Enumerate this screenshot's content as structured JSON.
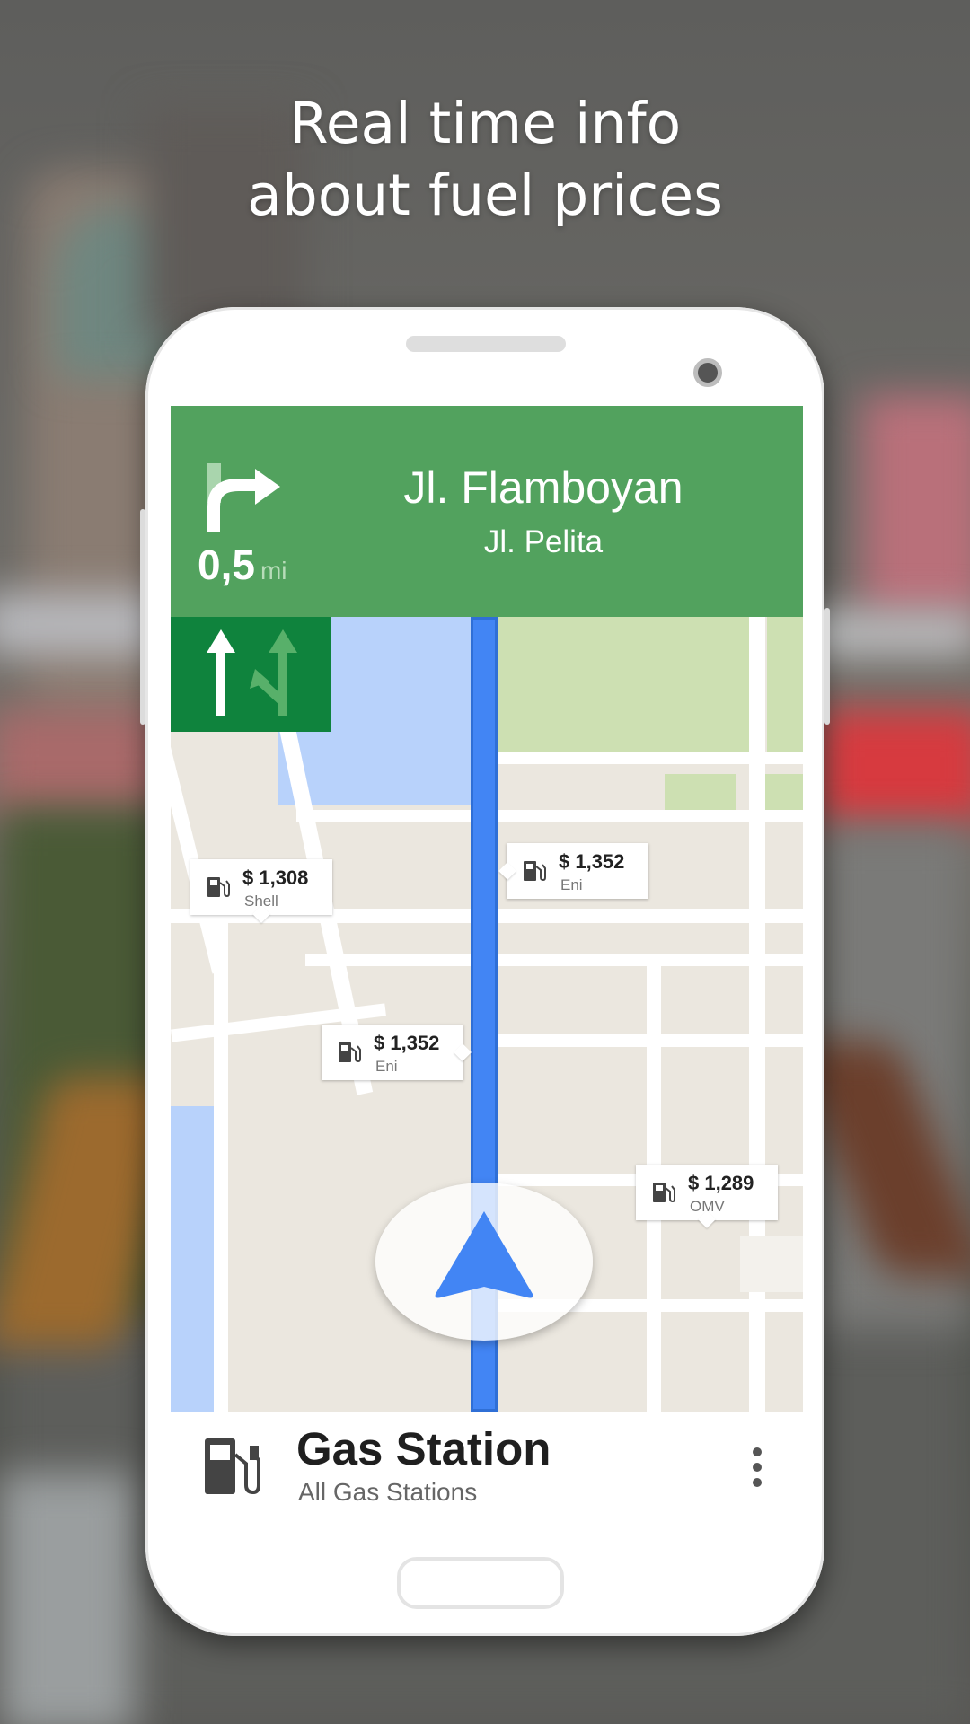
{
  "headline": {
    "line1": "Real time info",
    "line2": "about fuel prices"
  },
  "navigation": {
    "distance_value": "0,5",
    "distance_unit": "mi",
    "street_primary": "Jl. Flamboyan",
    "street_secondary": "Jl. Pelita",
    "lane_guidance": [
      "straight",
      "fork-left"
    ]
  },
  "map": {
    "price_tags": [
      {
        "price": "$ 1,308",
        "brand": "Shell"
      },
      {
        "price": "$ 1,352",
        "brand": "Eni"
      },
      {
        "price": "$ 1,352",
        "brand": "Eni"
      },
      {
        "price": "$ 1,289",
        "brand": "OMV"
      }
    ]
  },
  "bottom_card": {
    "title": "Gas Station",
    "subtitle": "All Gas Stations",
    "icon": "gas-pump-icon",
    "menu_icon": "more-vert-icon"
  },
  "colors": {
    "nav_green": "#52a25e",
    "lane_green": "#0f833d",
    "route_blue": "#4285f4"
  }
}
